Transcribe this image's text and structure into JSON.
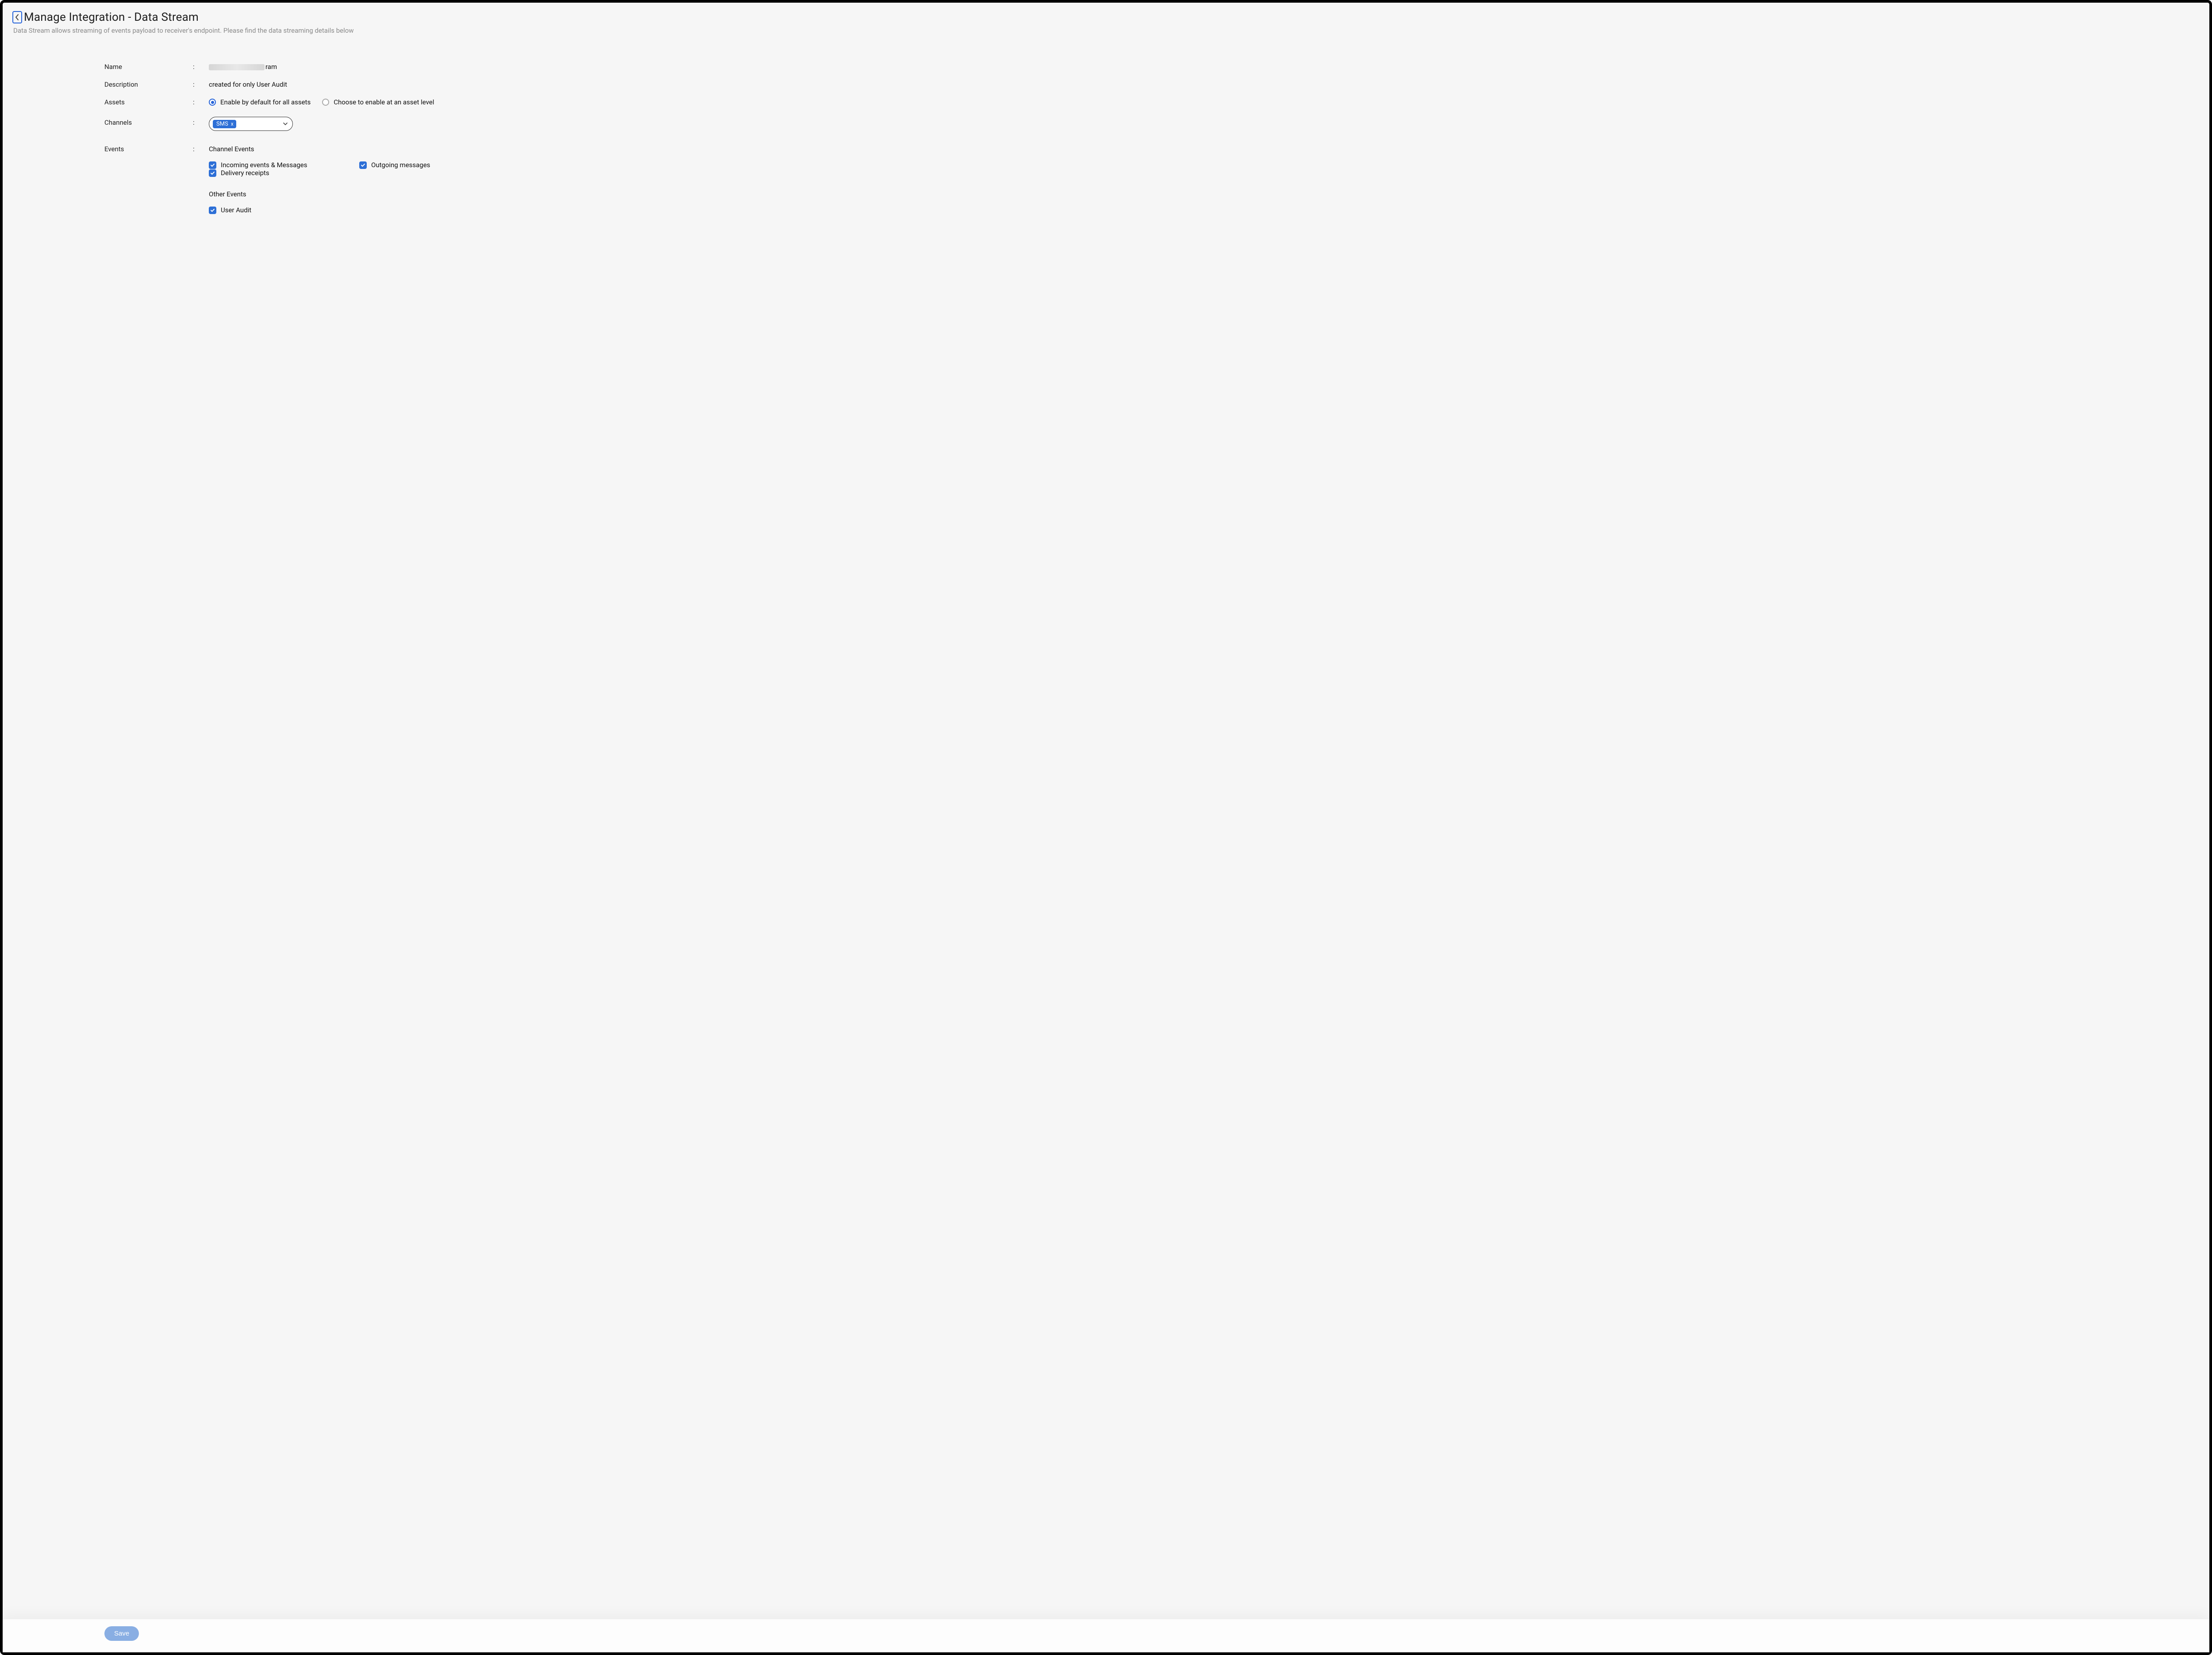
{
  "header": {
    "title": "Manage Integration - Data Stream",
    "subtitle": "Data Stream allows streaming of events payload to receiver's endpoint. Please find the data streaming details below"
  },
  "form": {
    "labels": {
      "name": "Name",
      "description": "Description",
      "assets": "Assets",
      "channels": "Channels",
      "events": "Events"
    },
    "colon": ":",
    "name_suffix": "ram",
    "description_value": "created for only User Audit",
    "assets": {
      "options": [
        {
          "label": "Enable by default for all assets",
          "selected": true
        },
        {
          "label": "Choose to enable at an asset level",
          "selected": false
        }
      ]
    },
    "channels": {
      "selected_chip": "SMS",
      "chip_close": "x"
    },
    "events": {
      "channel_heading": "Channel Events",
      "other_heading": "Other Events",
      "channel_events": [
        {
          "label": "Incoming events & Messages",
          "checked": true
        },
        {
          "label": "Outgoing messages",
          "checked": true
        },
        {
          "label": "Delivery receipts",
          "checked": true
        }
      ],
      "other_events": [
        {
          "label": "User Audit",
          "checked": true
        }
      ]
    }
  },
  "footer": {
    "save_label": "Save"
  }
}
